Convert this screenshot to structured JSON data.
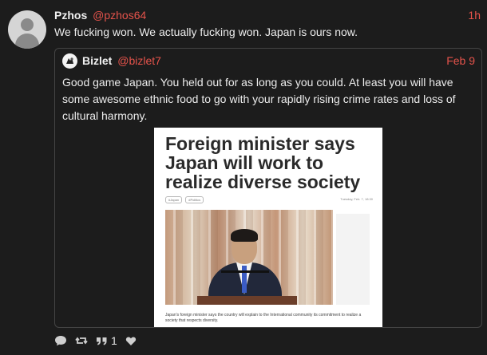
{
  "post": {
    "author_name": "Pzhos",
    "author_handle": "@pzhos64",
    "time": "1h",
    "text": "We fucking won. We actually fucking won. Japan is ours now."
  },
  "quote": {
    "author_name": "Bizlet",
    "author_handle": "@bizlet7",
    "time": "Feb 9",
    "text": "Good game Japan. You held out for as long as you could. At least you will have some awesome ethnic food to go with your rapidly rising crime rates and loss of cultural harmony.",
    "article": {
      "headline": "Foreign minister says Japan will work to realize diverse society",
      "tags": [
        "#Japan",
        "#Politics"
      ],
      "date": "Tuesday, Feb. 7, 18:30",
      "caption": "Japan's foreign minister says the country will explain to the International community its commitment to realize a society that respects diversity."
    }
  },
  "actions": {
    "reply_icon": "reply-icon",
    "repost_icon": "repost-icon",
    "quote_icon": "quote-icon",
    "quote_count": "1",
    "like_icon": "heart-icon"
  },
  "colors": {
    "background": "#1c1c1c",
    "accent": "#e5534b",
    "text": "#ececec"
  }
}
